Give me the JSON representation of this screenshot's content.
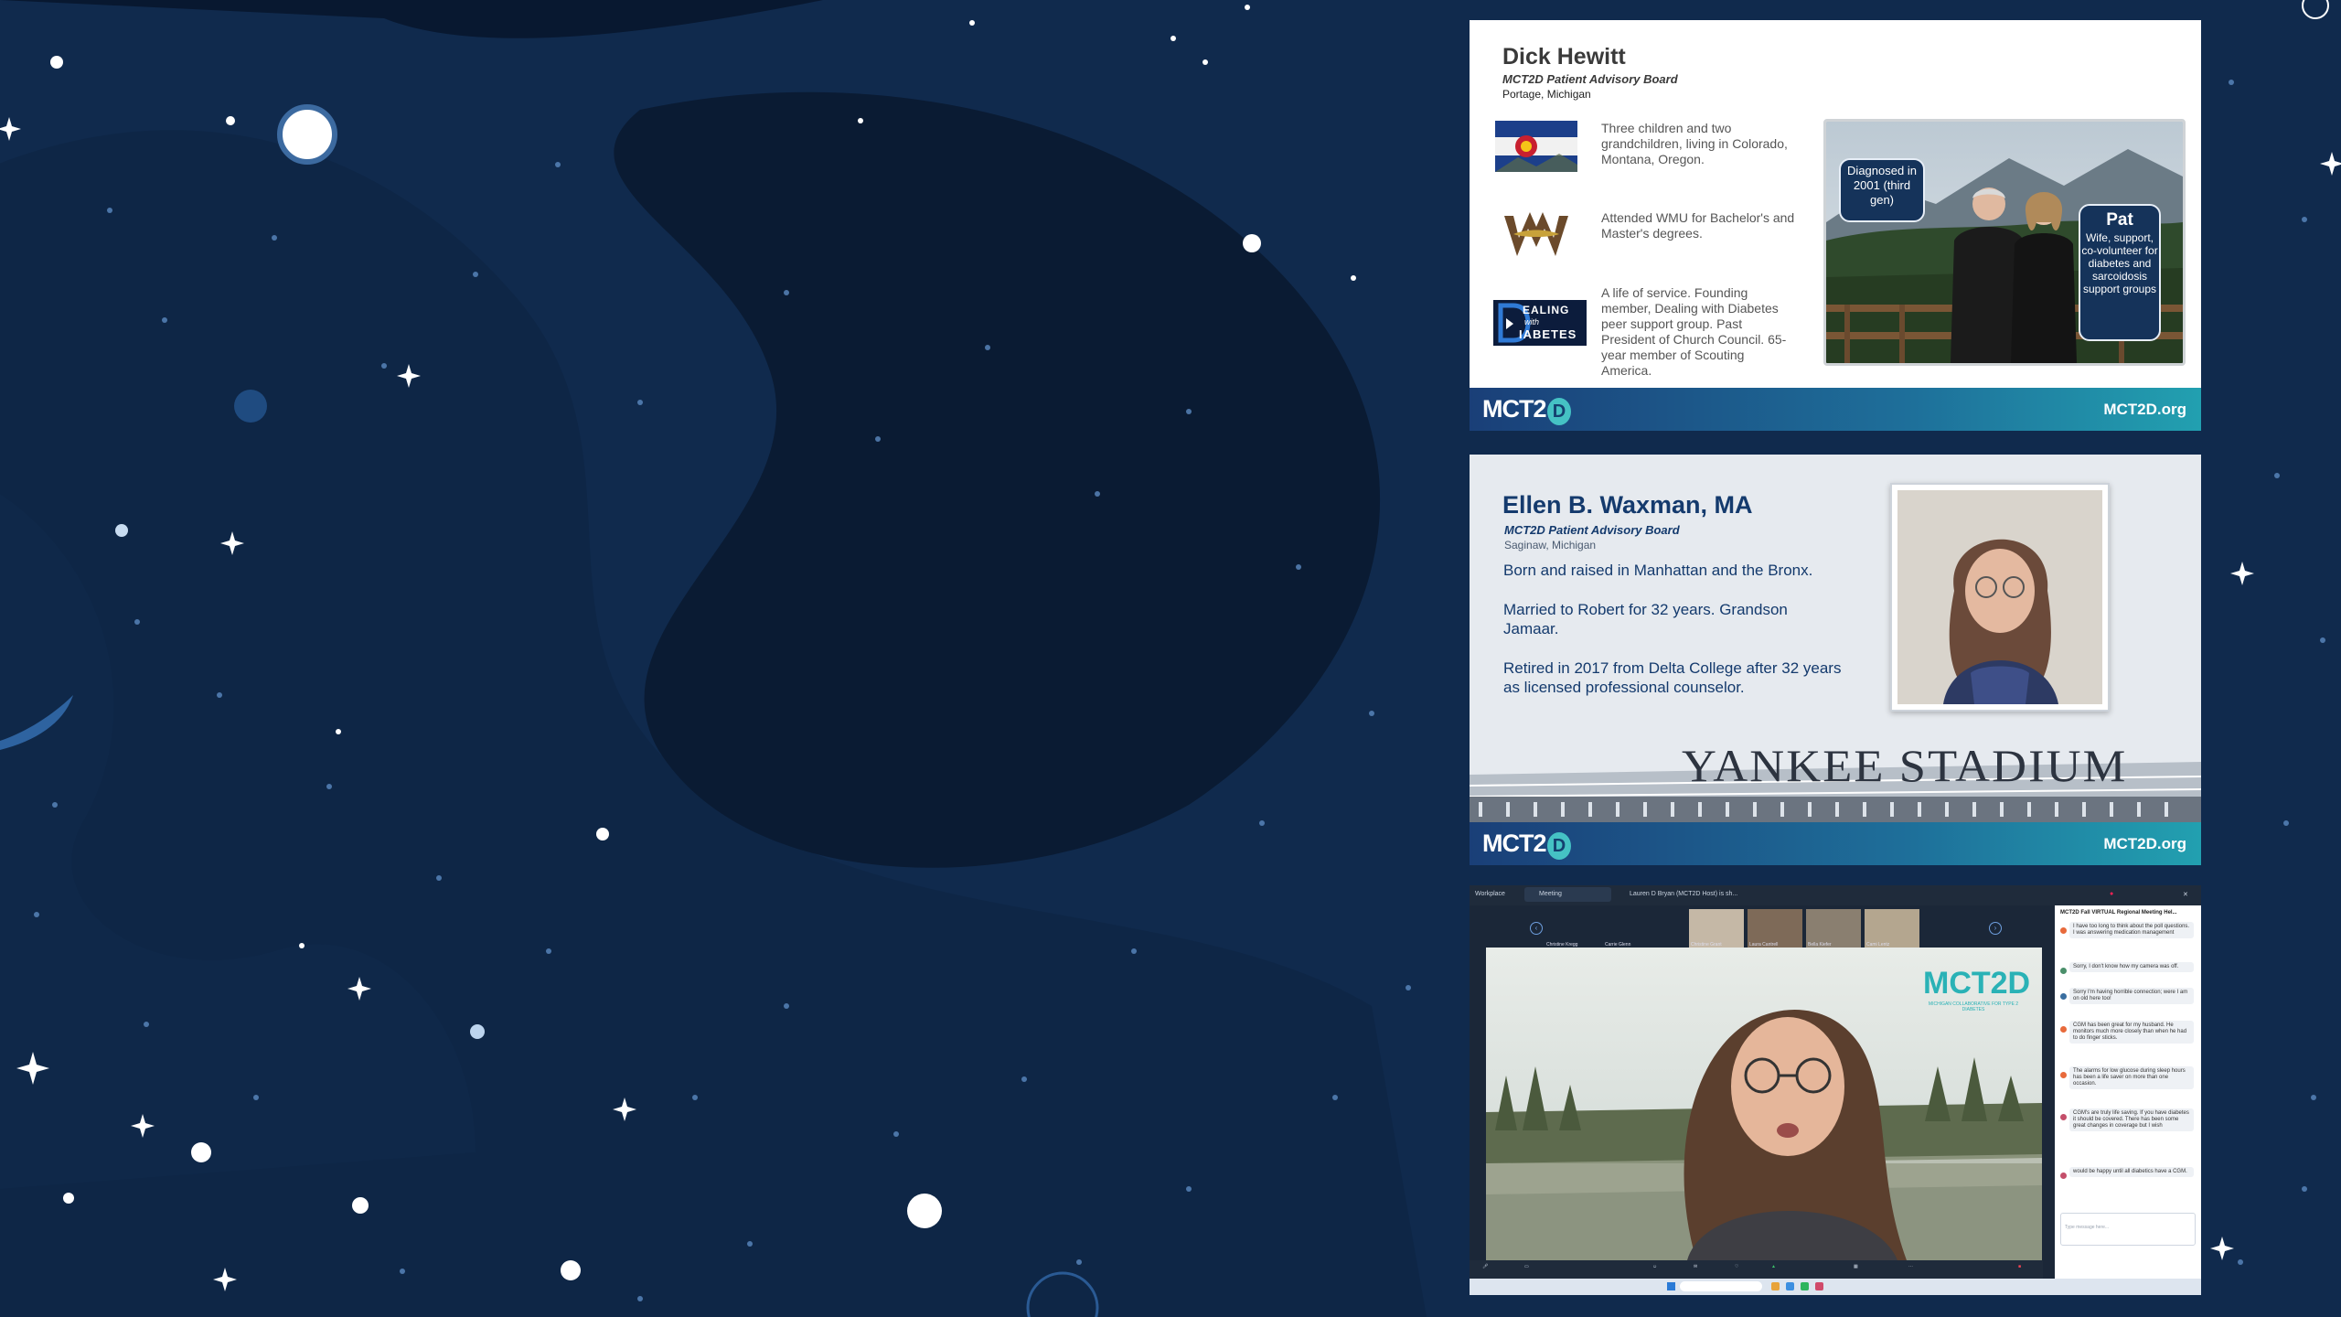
{
  "slide1": {
    "name": "Dick Hewitt",
    "role": "MCT2D Patient Advisory Board",
    "location": "Portage, Michigan",
    "facts": [
      {
        "icon": "colorado-flag-icon",
        "text": "Three children and two grandchildren, living in Colorado, Montana, Oregon."
      },
      {
        "icon": "wmu-logo-icon",
        "text": "Attended WMU for Bachelor's and Master's degrees."
      },
      {
        "icon": "dealing-with-diabetes-logo-icon",
        "logo_text": "DEALING with DIABETES",
        "text": "A life of service. Founding member, Dealing with Diabetes peer support group. Past President of Church Council. 65-year member of Scouting America."
      }
    ],
    "bubble_left": "Diagnosed in 2001 (third gen)",
    "bubble_right_name": "Pat",
    "bubble_right_text": "Wife, support, co-volunteer for diabetes and sarcoidosis support groups",
    "footer_logo": "MCT2",
    "footer_logo_d": "D",
    "footer_url": "MCT2D.org"
  },
  "slide2": {
    "name": "Ellen B. Waxman, MA",
    "role": "MCT2D Patient Advisory Board",
    "location": "Saginaw, Michigan",
    "lines": [
      "Born and raised in Manhattan and the Bronx.",
      "Married to Robert for 32 years. Grandson Jamaar.",
      "Retired in 2017 from Delta College after 32 years as licensed professional counselor."
    ],
    "stadium_text": "YANKEE STADIUM",
    "footer_logo": "MCT2",
    "footer_logo_d": "D",
    "footer_url": "MCT2D.org"
  },
  "slide3": {
    "app_name": "Workplace",
    "tab_meeting": "Meeting",
    "tab_share": "Lauren D Bryan (MCT2D Host) is sh...",
    "participants": [
      "Christine Kregg",
      "Carrie Glenn",
      "Christine Grant",
      "Laura Cantrell",
      "Bella Kiefer",
      "Cami Lentz"
    ],
    "logo_text": "MCT2D",
    "logo_sub": "MICHIGAN COLLABORATIVE FOR TYPE 2 DIABETES",
    "chat_title": "MCT2D Fall VIRTUAL Regional Meeting Hel...",
    "chat_messages": [
      "I have too long to think about the poll questions. I was answering medication management",
      "Sorry, I don't know how my camera was off.",
      "Sorry I'm having horrible connection; were I am on old here too!",
      "CGM has been great for my husband. He monitors much more closely than when he had to do finger sticks.",
      "The alarms for low glucose during sleep hours has been a life saver on more than one occasion.",
      "CGM's are truly life saving. If you have diabetes it should be covered. There has been some great changes in coverage but I wish",
      "would be happy until all diabetics have a CGM."
    ],
    "chat_placeholder": "Type message here..."
  }
}
